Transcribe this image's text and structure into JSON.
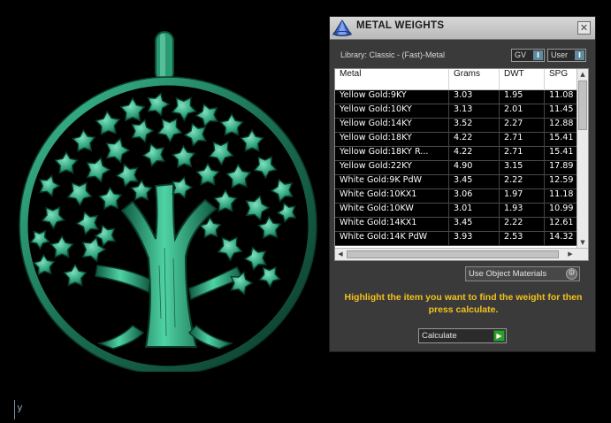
{
  "viewport": {
    "axis_label": "y"
  },
  "panel": {
    "title": "METAL WEIGHTS",
    "library": "Library: Classic - (Fast)-Metal",
    "toggles": [
      {
        "label": "GV",
        "indicator": "I"
      },
      {
        "label": "User",
        "indicator": "I"
      }
    ],
    "table": {
      "columns": [
        "Metal",
        "Grams",
        "DWT",
        "SPG"
      ],
      "rows": [
        [
          "Yellow Gold:9KY",
          "3.03",
          "1.95",
          "11.08"
        ],
        [
          "Yellow Gold:10KY",
          "3.13",
          "2.01",
          "11.45"
        ],
        [
          "Yellow Gold:14KY",
          "3.52",
          "2.27",
          "12.88"
        ],
        [
          "Yellow Gold:18KY",
          "4.22",
          "2.71",
          "15.41"
        ],
        [
          "Yellow Gold:18KY R...",
          "4.22",
          "2.71",
          "15.41"
        ],
        [
          "Yellow Gold:22KY",
          "4.90",
          "3.15",
          "17.89"
        ],
        [
          "White Gold:9K PdW",
          "3.45",
          "2.22",
          "12.59"
        ],
        [
          "White Gold:10KX1",
          "3.06",
          "1.97",
          "11.18"
        ],
        [
          "White Gold:10KW",
          "3.01",
          "1.93",
          "10.99"
        ],
        [
          "White Gold:14KX1",
          "3.45",
          "2.22",
          "12.61"
        ],
        [
          "White Gold:14K PdW",
          "3.93",
          "2.53",
          "14.32"
        ]
      ]
    },
    "use_materials_label": "Use Object Materials",
    "instruction": "Highlight the item you want to find the weight for then press calculate.",
    "calculate_label": "Calculate",
    "close_glyph": "✕",
    "scroll_up_glyph": "▲",
    "scroll_down_glyph": "▼",
    "scroll_left_glyph": "◀",
    "scroll_right_glyph": "▶",
    "gear_glyph": "⚙",
    "go_glyph": "▶",
    "icons": {
      "title": "pyramid-logo-icon",
      "close": "close-icon",
      "settings": "gear-icon",
      "calculate": "play-icon"
    },
    "colors": {
      "pendant": "#1f7a5c",
      "instruction": "#f2c21b",
      "calculate_go": "#2f9e2f",
      "toggle_indicator": "#5f8aa0"
    }
  }
}
